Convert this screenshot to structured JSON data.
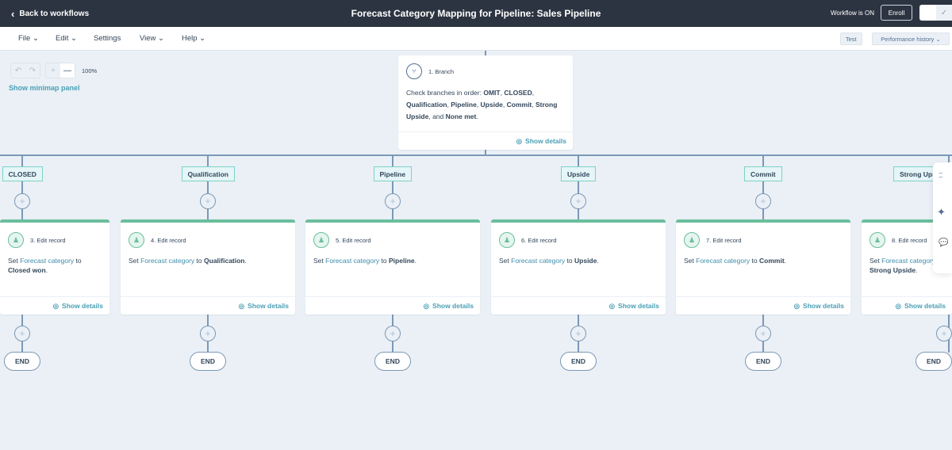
{
  "header": {
    "back": "Back to workflows",
    "title": "Forecast Category Mapping for Pipeline: Sales Pipeline",
    "status": "Workflow is ON",
    "enroll": "Enroll"
  },
  "menu": {
    "items": [
      "File",
      "Edit",
      "Settings",
      "View",
      "Help"
    ],
    "test": "Test",
    "performance": "Performance history"
  },
  "canvas": {
    "zoom": "100%",
    "minimap": "Show minimap panel"
  },
  "branch": {
    "title": "1. Branch",
    "prefix": "Check branches in order: ",
    "b1": "OMIT",
    "b2": "CLOSED",
    "b3": "Qualification",
    "b4": "Pipeline",
    "b5": "Upside",
    "b6": "Commit",
    "b7": "Strong Upside",
    "and": "and",
    "b8": "None met",
    "details": "Show details"
  },
  "branches": [
    {
      "label": "CLOSED",
      "title": "3. Edit record",
      "set": "Set",
      "prop": "Forecast category",
      "to": "to",
      "value": "Closed won"
    },
    {
      "label": "Qualification",
      "title": "4. Edit record",
      "set": "Set",
      "prop": "Forecast category",
      "to": "to",
      "value": "Qualification"
    },
    {
      "label": "Pipeline",
      "title": "5. Edit record",
      "set": "Set",
      "prop": "Forecast category",
      "to": "to",
      "value": "Pipeline"
    },
    {
      "label": "Upside",
      "title": "6. Edit record",
      "set": "Set",
      "prop": "Forecast category",
      "to": "to",
      "value": "Upside"
    },
    {
      "label": "Commit",
      "title": "7. Edit record",
      "set": "Set",
      "prop": "Forecast category",
      "to": "to",
      "value": "Commit"
    },
    {
      "label": "Strong Upside",
      "title": "8. Edit record",
      "set": "Set",
      "prop": "Forecast category",
      "to": "to",
      "value": "Strong Upside"
    }
  ],
  "show_details": "Show details",
  "end": "END",
  "colors": {
    "header": "#2d3441",
    "accent": "#6bbe9c",
    "link": "#3e8dab",
    "canvas": "#eaf0f6"
  }
}
